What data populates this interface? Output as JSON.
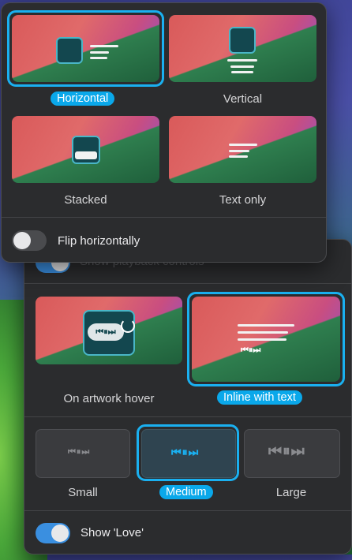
{
  "layout_options": [
    {
      "label": "Horizontal",
      "selected": true
    },
    {
      "label": "Vertical",
      "selected": false
    },
    {
      "label": "Stacked",
      "selected": false
    },
    {
      "label": "Text only",
      "selected": false
    }
  ],
  "flip_toggle": {
    "label": "Flip horizontally",
    "on": false
  },
  "playback_toggle": {
    "label": "Show playback controls",
    "on": true
  },
  "controls_position": [
    {
      "label": "On artwork hover",
      "selected": false
    },
    {
      "label": "Inline with text",
      "selected": true
    }
  ],
  "control_sizes": [
    {
      "label": "Small",
      "selected": false
    },
    {
      "label": "Medium",
      "selected": true
    },
    {
      "label": "Large",
      "selected": false
    }
  ],
  "love_toggle": {
    "label": "Show 'Love'",
    "on": true
  },
  "glyphs": {
    "playback": "⏮⏸⏭"
  },
  "colors": {
    "accent": "#0aa8ea",
    "toggle_on": "#3a8fe0",
    "panel": "#2b2c2e"
  }
}
